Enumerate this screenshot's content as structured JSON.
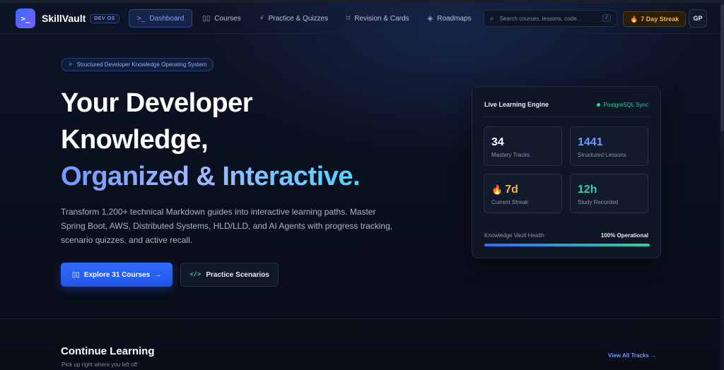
{
  "brand": {
    "logo_glyph": ">_",
    "name": "SkillVault",
    "badge": "DEV OS",
    "accent": "#2f6bff"
  },
  "nav": {
    "links": [
      {
        "label": "Dashboard",
        "icon": ">_",
        "icon_name": "terminal-icon",
        "active": true
      },
      {
        "label": "Courses",
        "icon": "▯▯",
        "icon_name": "book-icon",
        "active": false
      },
      {
        "label": "Practice & Quizzes",
        "icon": "⚡",
        "icon_name": "lightning-icon",
        "active": false
      },
      {
        "label": "Revision & Cards",
        "icon": "⌑",
        "icon_name": "bookmark-icon",
        "active": false
      },
      {
        "label": "Roadmaps",
        "icon": "◈",
        "icon_name": "layers-icon",
        "active": false
      }
    ],
    "search_placeholder": "Search courses, lessons, code...",
    "search_shortcut": "/",
    "streak_label": "7 Day Streak",
    "avatar_initials": "GP"
  },
  "hero": {
    "pill_text": "Structured Developer Knowledge Operating System",
    "title_line1": "Your Developer",
    "title_line2": "Knowledge,",
    "title_line3": "Organized & Interactive.",
    "description": "Transform 1,200+ technical Markdown guides into interactive learning paths. Master Spring Boot, AWS, Distributed Systems, HLD/LLD, and AI Agents with progress tracking, scenario quizzes, and active recall.",
    "primary_button": "Explore 31 Courses",
    "secondary_button": "Practice Scenarios"
  },
  "engine": {
    "title": "Live Learning Engine",
    "sync_label": "PostgreSQL Sync",
    "stats": [
      {
        "value": "34",
        "label": "Mastery Tracks"
      },
      {
        "value": "1441",
        "label": "Structured Lessons"
      },
      {
        "value": "7d",
        "label": "Current Streak"
      },
      {
        "value": "12h",
        "label": "Study Recorded"
      }
    ],
    "health_label": "Knowledge Vault Health",
    "health_value": "100% Operational",
    "health_percent": 100
  },
  "continue": {
    "title": "Continue Learning",
    "subtitle": "Pick up right where you left off",
    "view_all": "View All Tracks"
  }
}
